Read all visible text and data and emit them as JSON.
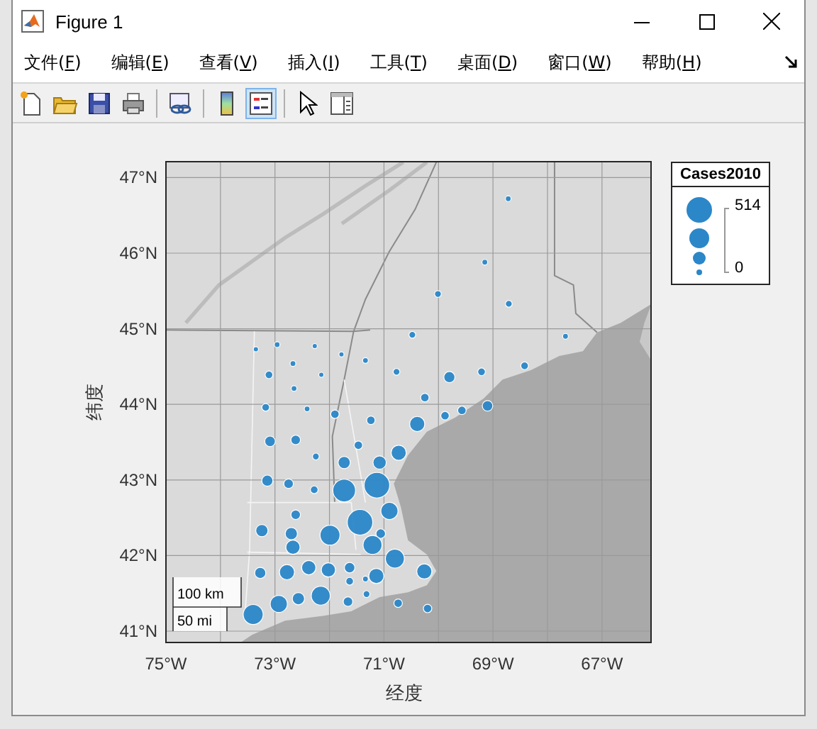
{
  "window": {
    "title": "Figure 1"
  },
  "menu": [
    "文件(F)",
    "编辑(E)",
    "查看(V)",
    "插入(I)",
    "工具(T)",
    "桌面(D)",
    "窗口(W)",
    "帮助(H)"
  ],
  "toolbar": [
    [
      {
        "kind": "new",
        "selected": false
      },
      {
        "kind": "open",
        "selected": false
      },
      {
        "kind": "save",
        "selected": false
      },
      {
        "kind": "print",
        "selected": false
      }
    ],
    [
      {
        "kind": "link",
        "selected": false
      }
    ],
    [
      {
        "kind": "colorbar",
        "selected": false
      },
      {
        "kind": "legend",
        "selected": true
      }
    ],
    [
      {
        "kind": "pointer",
        "selected": false
      },
      {
        "kind": "inspector",
        "selected": false
      }
    ]
  ],
  "figure": {
    "chart_data": {
      "type": "scatter",
      "xlabel": "经度",
      "ylabel": "纬度",
      "xlim": [
        -75,
        -66.1
      ],
      "ylim": [
        40.85,
        47.21
      ],
      "xticks": [
        {
          "value": -75,
          "label": "75°W"
        },
        {
          "value": -73,
          "label": "73°W"
        },
        {
          "value": -71,
          "label": "71°W"
        },
        {
          "value": -69,
          "label": "69°W"
        },
        {
          "value": -67,
          "label": "67°W"
        }
      ],
      "yticks": [
        {
          "value": 41,
          "label": "41°N"
        },
        {
          "value": 42,
          "label": "42°N"
        },
        {
          "value": 43,
          "label": "43°N"
        },
        {
          "value": 44,
          "label": "44°N"
        },
        {
          "value": 45,
          "label": "45°N"
        },
        {
          "value": 46,
          "label": "46°N"
        },
        {
          "value": 47,
          "label": "47°N"
        }
      ],
      "x": [
        -68.72,
        -69.15,
        -70.01,
        -68.71,
        -70.48,
        -67.67,
        -73.35,
        -72.96,
        -72.27,
        -71.78,
        -71.34,
        -72.67,
        -72.15,
        -73.11,
        -70.77,
        -69.8,
        -69.21,
        -68.42,
        -72.65,
        -73.17,
        -72.41,
        -70.25,
        -71.9,
        -71.24,
        -69.88,
        -69.57,
        -69.1,
        -70.39,
        -73.09,
        -72.62,
        -71.47,
        -70.73,
        -72.25,
        -71.73,
        -71.08,
        -73.14,
        -72.75,
        -72.28,
        -71.73,
        -71.13,
        -70.9,
        -72.62,
        -71.44,
        -71.06,
        -73.24,
        -72.7,
        -71.99,
        -71.21,
        -72.67,
        -70.8,
        -73.27,
        -72.78,
        -72.38,
        -72.02,
        -71.63,
        -70.26,
        -71.34,
        -71.14,
        -71.63,
        -72.93,
        -72.57,
        -72.16,
        -71.66,
        -71.32,
        -70.74,
        -70.2,
        -73.4
      ],
      "series": [
        {
          "name": "Cases2010",
          "color": "#2b87c8",
          "values": [
            46.72,
            45.88,
            45.46,
            45.33,
            44.92,
            44.9,
            44.73,
            44.79,
            44.77,
            44.66,
            44.58,
            44.54,
            44.39,
            44.39,
            44.43,
            44.36,
            44.43,
            44.51,
            44.21,
            43.96,
            43.94,
            44.09,
            43.87,
            43.79,
            43.85,
            43.92,
            43.98,
            43.74,
            43.51,
            43.53,
            43.46,
            43.36,
            43.31,
            43.23,
            43.23,
            42.99,
            42.95,
            42.87,
            42.86,
            42.93,
            42.59,
            42.54,
            42.44,
            42.29,
            42.33,
            42.29,
            42.27,
            42.14,
            42.11,
            41.96,
            41.77,
            41.78,
            41.84,
            41.81,
            41.84,
            41.79,
            41.69,
            41.73,
            41.66,
            41.36,
            41.43,
            41.47,
            41.39,
            41.49,
            41.37,
            41.3,
            41.22
          ],
          "sizes": [
            0.05,
            0.05,
            0.07,
            0.07,
            0.07,
            0.05,
            0.04,
            0.05,
            0.04,
            0.04,
            0.05,
            0.05,
            0.04,
            0.09,
            0.07,
            0.19,
            0.09,
            0.09,
            0.05,
            0.09,
            0.05,
            0.11,
            0.11,
            0.11,
            0.11,
            0.11,
            0.17,
            0.35,
            0.17,
            0.14,
            0.11,
            0.35,
            0.07,
            0.23,
            0.27,
            0.19,
            0.14,
            0.09,
            0.79,
            1,
            0.45,
            0.14,
            1,
            0.14,
            0.23,
            0.23,
            0.61,
            0.55,
            0.31,
            0.55,
            0.19,
            0.35,
            0.31,
            0.31,
            0.17,
            0.35,
            0.05,
            0.35,
            0.09,
            0.45,
            0.23,
            0.55,
            0.14,
            0.07,
            0.11,
            0.11,
            0.61
          ]
        }
      ],
      "grid": true
    },
    "scale_bar": [
      "100 km",
      "50 mi"
    ],
    "legend": {
      "max": "514",
      "min": "0"
    }
  }
}
